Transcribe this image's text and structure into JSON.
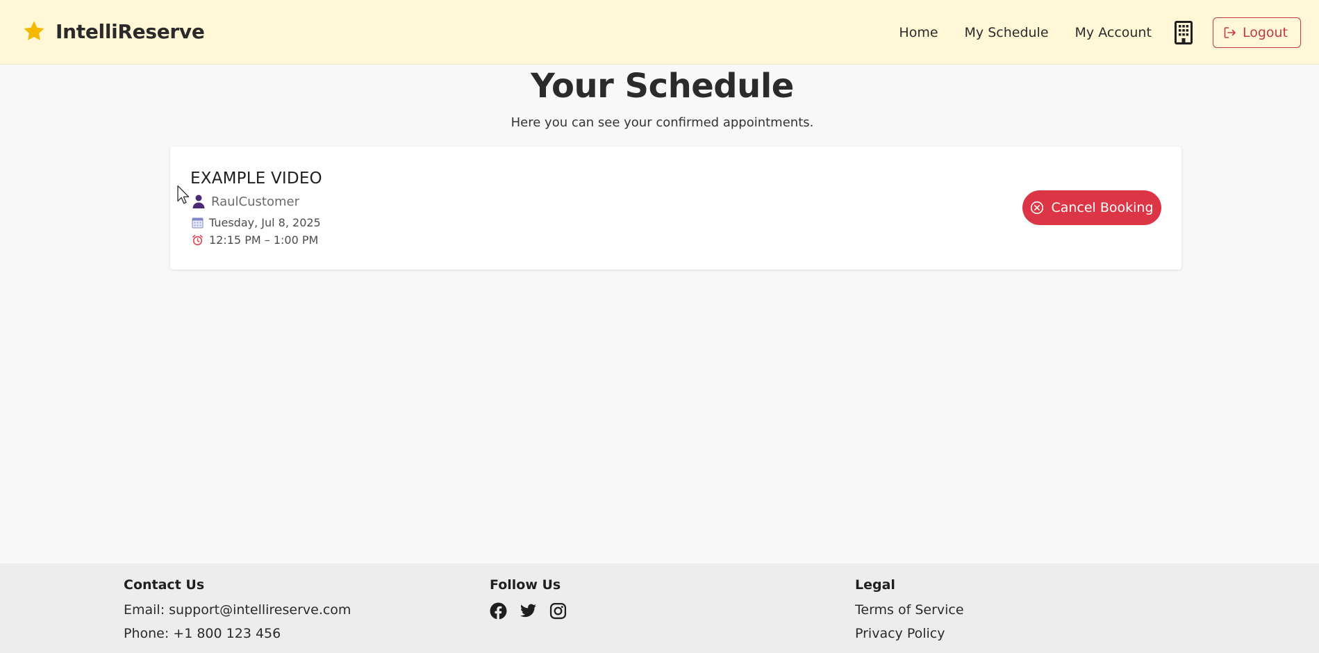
{
  "app": {
    "brand_name": "IntelliReserve",
    "brand_icon": "star-icon",
    "brand_color": "#f5b800"
  },
  "nav": {
    "items": [
      {
        "label": "Home"
      },
      {
        "label": "My Schedule"
      },
      {
        "label": "My Account"
      }
    ],
    "business_icon": "building-icon",
    "logout_label": "Logout",
    "logout_icon": "logout-icon"
  },
  "page": {
    "title": "Your Schedule",
    "subtitle": "Here you can see your confirmed appointments."
  },
  "bookings": [
    {
      "title": "EXAMPLE VIDEO",
      "customer": "RaulCustomer",
      "date": "Tuesday, Jul 8, 2025",
      "time": "12:15 PM – 1:00 PM",
      "cancel_label": "Cancel Booking"
    }
  ],
  "footer": {
    "contact": {
      "heading": "Contact Us",
      "email": "Email: support@intellireserve.com",
      "phone": "Phone: +1 800 123 456"
    },
    "follow": {
      "heading": "Follow Us",
      "icons": [
        "facebook-icon",
        "twitter-icon",
        "instagram-icon"
      ]
    },
    "legal": {
      "heading": "Legal",
      "links": [
        {
          "label": "Terms of Service"
        },
        {
          "label": "Privacy Policy"
        }
      ]
    }
  },
  "colors": {
    "navbar_bg": "#fff7d6",
    "danger": "#dc3545",
    "page_bg": "#f8f8f8",
    "footer_bg": "#ededed"
  }
}
